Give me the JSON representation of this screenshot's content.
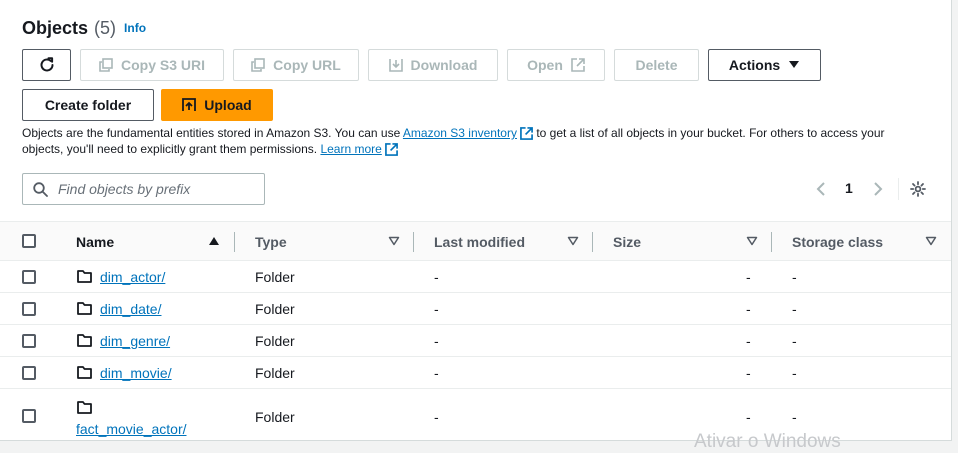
{
  "header": {
    "title": "Objects",
    "count": "(5)",
    "info": "Info"
  },
  "toolbar": {
    "copy_s3_uri": "Copy S3 URI",
    "copy_url": "Copy URL",
    "download": "Download",
    "open": "Open",
    "delete": "Delete",
    "actions": "Actions",
    "create_folder": "Create folder",
    "upload": "Upload"
  },
  "description": {
    "part1": "Objects are the fundamental entities stored in Amazon S3. You can use ",
    "inventory_link": "Amazon S3 inventory",
    "part2": " to get a list of all objects in your bucket. For others to access your objects, you'll need to explicitly grant them permissions. ",
    "learn_more": "Learn more"
  },
  "search": {
    "placeholder": "Find objects by prefix",
    "value": ""
  },
  "pagination": {
    "page": "1"
  },
  "table": {
    "columns": {
      "name": "Name",
      "type": "Type",
      "last_modified": "Last modified",
      "size": "Size",
      "storage_class": "Storage class"
    },
    "rows": [
      {
        "name": "dim_actor/",
        "type": "Folder",
        "last_modified": "-",
        "size": "-",
        "storage_class": "-"
      },
      {
        "name": "dim_date/",
        "type": "Folder",
        "last_modified": "-",
        "size": "-",
        "storage_class": "-"
      },
      {
        "name": "dim_genre/",
        "type": "Folder",
        "last_modified": "-",
        "size": "-",
        "storage_class": "-"
      },
      {
        "name": "dim_movie/",
        "type": "Folder",
        "last_modified": "-",
        "size": "-",
        "storage_class": "-"
      },
      {
        "name": "fact_movie_actor/",
        "type": "Folder",
        "last_modified": "-",
        "size": "-",
        "storage_class": "-"
      }
    ]
  },
  "watermark": "Ativar o Windows",
  "icons": {
    "refresh": "refresh-icon",
    "copy": "copy-icon",
    "download": "download-icon",
    "external": "external-link-icon",
    "caret": "caret-down-icon",
    "upload": "upload-icon",
    "search": "search-icon",
    "chevron_left": "chevron-left-icon",
    "chevron_right": "chevron-right-icon",
    "settings": "gear-icon",
    "folder": "folder-icon",
    "sort_asc": "sort-ascending-icon",
    "sort": "sort-icon"
  },
  "colors": {
    "accent": "#ff9900",
    "link": "#0073bb",
    "text": "#16191f",
    "muted": "#545b64",
    "disabled": "#aab7b8"
  }
}
